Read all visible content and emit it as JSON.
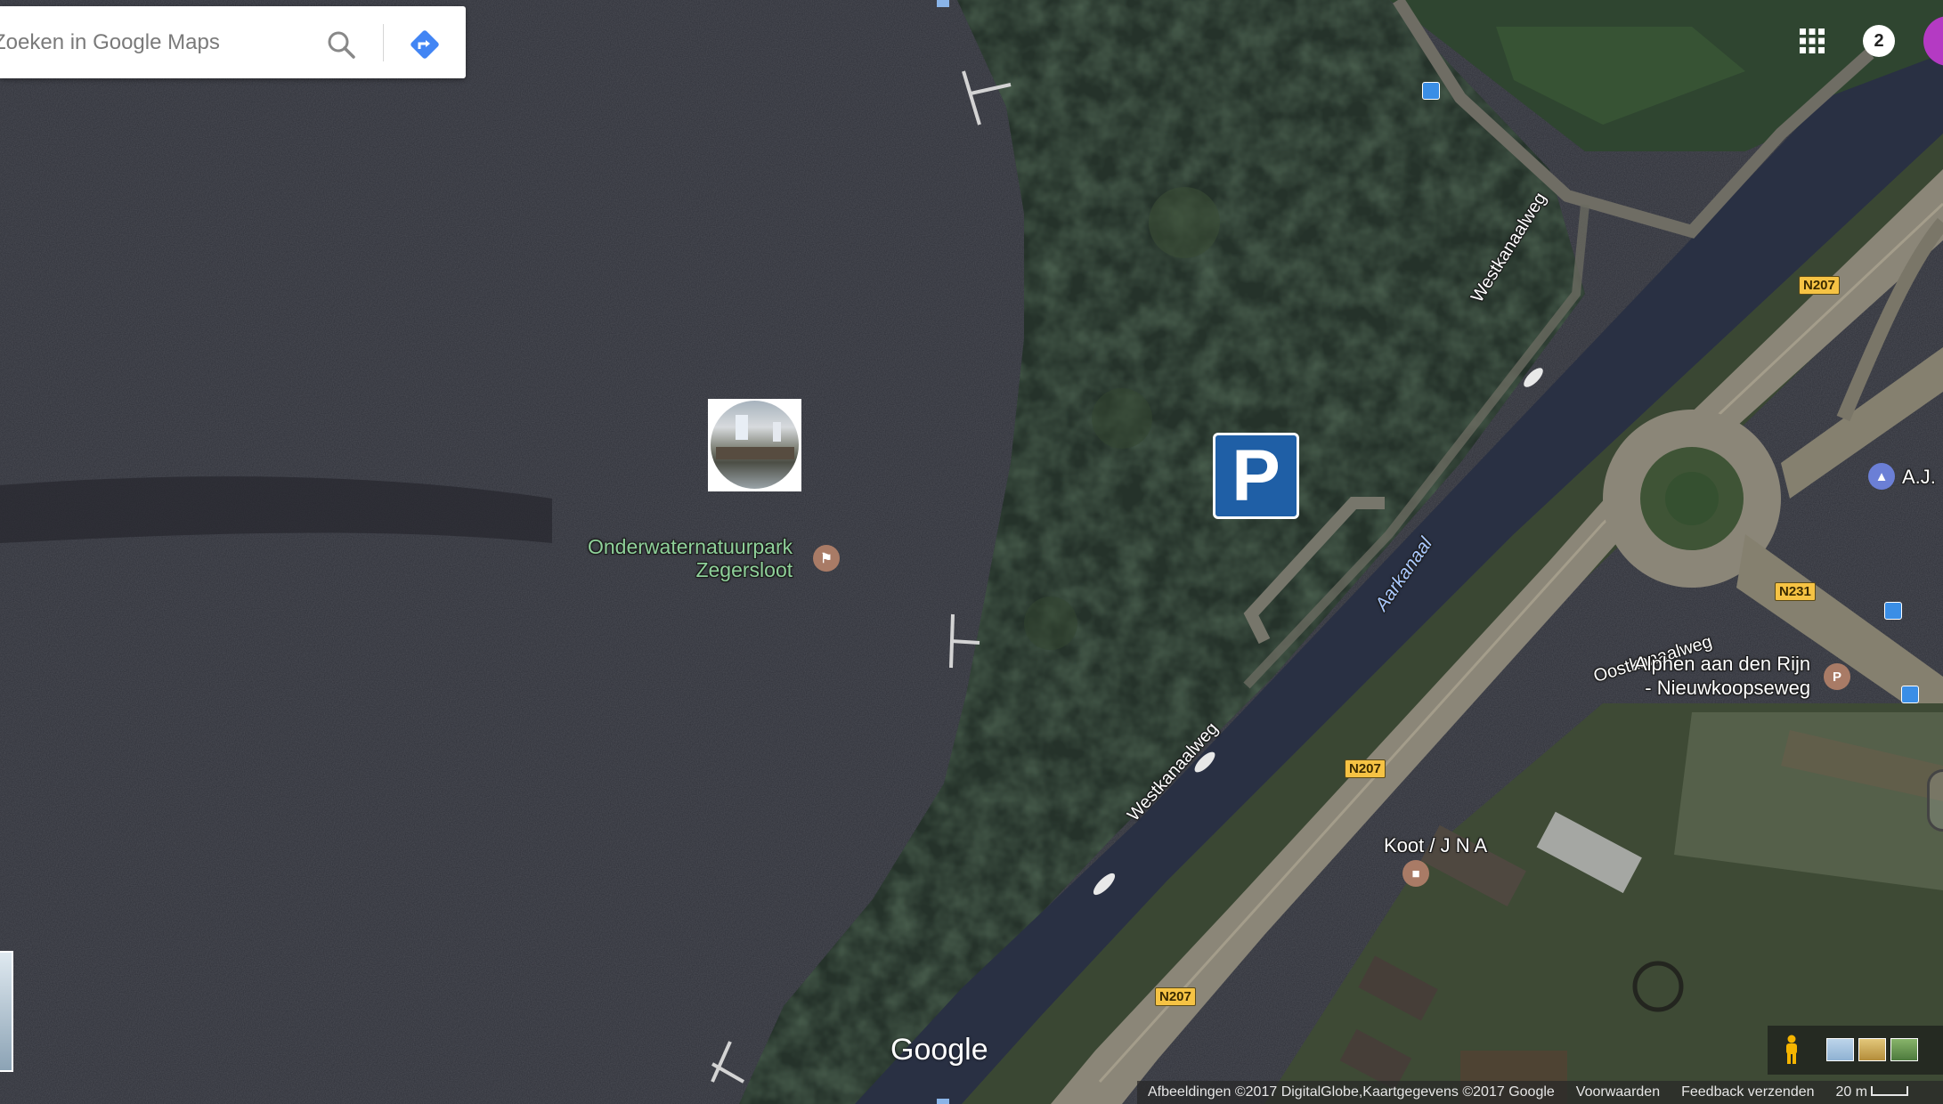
{
  "search": {
    "placeholder": "Zoeken in Google Maps"
  },
  "header": {
    "notification_count": "2"
  },
  "places": {
    "underwater_park_line1": "Onderwaternatuurpark",
    "underwater_park_line2": "Zegersloot",
    "koot": "Koot / J N A",
    "bus_stop_line1": "Alphen aan den Rijn",
    "bus_stop_line2": "- Nieuwkoopseweg",
    "aj": "A.J."
  },
  "parking_sign": "P",
  "roads": {
    "westkanaalweg": "Westkanaalweg",
    "oostkanaalweg": "Oostkanaalweg",
    "aarkanaal": "Aarkanaal",
    "n207": "N207",
    "n231": "N231"
  },
  "brand": {
    "logo": "Google"
  },
  "footer": {
    "attribution": "Afbeeldingen ©2017 DigitalGlobe,Kaartgegevens ©2017 Google",
    "terms": "Voorwaarden",
    "feedback": "Feedback verzenden",
    "scale": "20 m"
  },
  "colors": {
    "water": "#2f3139",
    "forest": "#27342a",
    "canal": "#293043",
    "road": "#8f8a7a",
    "search_accent": "#4285f4",
    "parking": "#1f5fa6",
    "avatar": "#b43ac3"
  }
}
